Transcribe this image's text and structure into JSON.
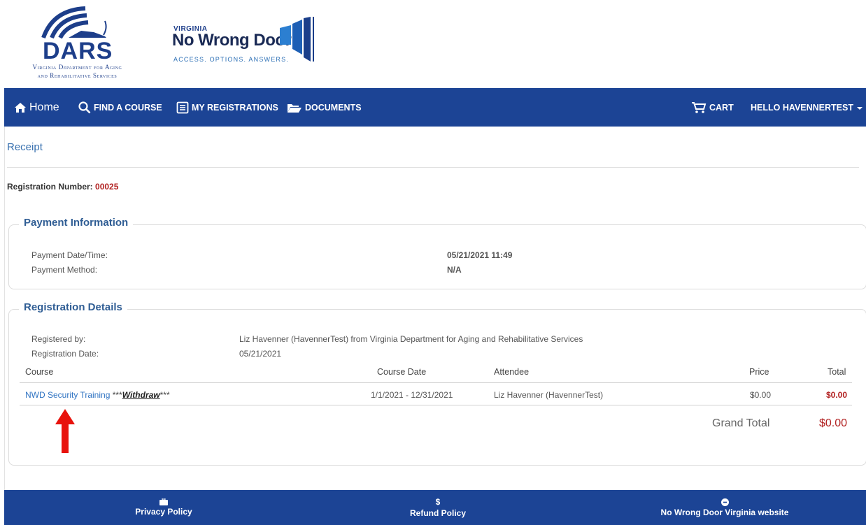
{
  "logos": {
    "dars_word": "DARS",
    "dars_sub_line1": "Virginia Department for Aging",
    "dars_sub_line2": "and Rehabilitative Services",
    "nwd_state": "VIRGINIA",
    "nwd_name": "No Wrong Door",
    "nwd_tagline": "ACCESS. OPTIONS. ANSWERS."
  },
  "nav": {
    "home": "Home",
    "find_course": "FIND A COURSE",
    "my_registrations": "MY REGISTRATIONS",
    "documents": "DOCUMENTS",
    "cart": "CART",
    "user": "HELLO HAVENNERTEST"
  },
  "page": {
    "title": "Receipt",
    "registration_number_label": "Registration Number:",
    "registration_number": "00025"
  },
  "payment": {
    "legend": "Payment Information",
    "date_label": "Payment Date/Time:",
    "date_value": "05/21/2021 11:49",
    "method_label": "Payment Method:",
    "method_value": "N/A"
  },
  "details": {
    "legend": "Registration Details",
    "registered_by_label": "Registered by:",
    "registered_by_value": "Liz Havenner (HavennerTest) from Virginia Department for Aging and Rehabilitative Services",
    "registration_date_label": "Registration Date:",
    "registration_date_value": "05/21/2021",
    "columns": {
      "course": "Course",
      "course_date": "Course Date",
      "attendee": "Attendee",
      "price": "Price",
      "total": "Total"
    },
    "row": {
      "course": "NWD Security Training",
      "stars_before": "***",
      "withdraw": "Withdraw",
      "stars_after": "***",
      "course_date": "1/1/2021 - 12/31/2021",
      "attendee": "Liz Havenner (HavennerTest)",
      "price": "$0.00",
      "total": "$0.00"
    },
    "grand_total_label": "Grand Total",
    "grand_total_value": "$0.00"
  },
  "footer": {
    "privacy": "Privacy Policy",
    "refund_icon": "$",
    "refund": "Refund Policy",
    "nwd_site": "No Wrong Door Virginia website"
  },
  "colors": {
    "nav_bg": "#1c4495",
    "accent_red": "#b22222",
    "link_blue": "#2f73c2",
    "annotation_arrow": "#e8120c"
  }
}
